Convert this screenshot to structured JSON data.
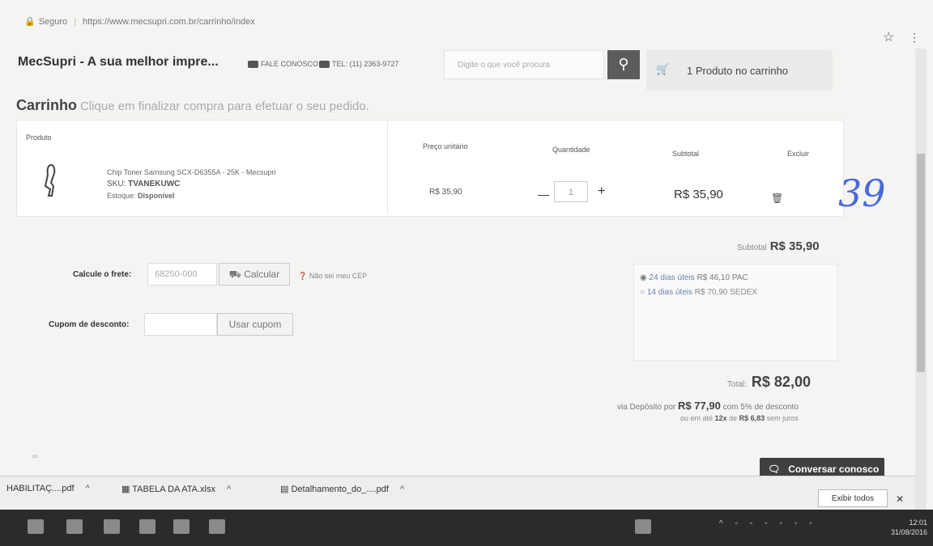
{
  "browser": {
    "secure_label": "Seguro",
    "url": "https://www.mecsupri.com.br/carrinho/index"
  },
  "header": {
    "site_title": "MecSupri - A sua melhor impre...",
    "contact_label": "FALE CONOSCO",
    "phone_label": "TEL: (11) 2363-9727",
    "search_placeholder": "Digite o que você procura",
    "cart_label": "1 Produto no carrinho"
  },
  "page": {
    "title": "Carrinho",
    "subtitle": "Clique em finalizar compra para efetuar o seu pedido."
  },
  "table": {
    "headers": {
      "product": "Produto",
      "unit_price": "Preço unitário",
      "quantity": "Quantidade",
      "subtotal": "Subtotal",
      "delete": "Excluir"
    },
    "rows": [
      {
        "name": "Chip Toner Samsung SCX-D6355A - 25K - Mecsupri",
        "sku_label": "SKU:",
        "sku": "TVANEKUWC",
        "stock_label": "Estoque:",
        "stock": "Disponível",
        "unit_price": "R$ 35,90",
        "quantity": "1",
        "subtotal": "R$ 35,90"
      }
    ]
  },
  "handwritten_note": "39",
  "summary": {
    "subtotal_label": "Subtotal",
    "subtotal_value": "R$ 35,90",
    "shipping_label": "Calcule o frete:",
    "cep_value": "68250-000",
    "calc_button": "Calcular",
    "cep_help": "Não sei meu CEP",
    "shipping_options": [
      {
        "days": "24 dias úteis",
        "price": "R$ 46,10",
        "carrier": "PAC",
        "selected": true
      },
      {
        "days": "14 dias úteis",
        "price": "R$ 70,90",
        "carrier": "SEDEX",
        "selected": false
      }
    ],
    "coupon_label": "Cupom de desconto:",
    "coupon_button": "Usar cupom",
    "total_label": "Total:",
    "total_value": "R$ 82,00",
    "deposit_prefix": "via Depósito por",
    "deposit_value": "R$ 77,90",
    "deposit_suffix": "com 5% de desconto",
    "installment_prefix": "ou em até",
    "installment_count": "12x",
    "installment_of": "de",
    "installment_value": "R$ 6,83",
    "installment_suffix": "sem juros"
  },
  "chat_button": "Conversar conosco",
  "downloads": {
    "items": [
      "HABILITAÇ....pdf",
      "TABELA DA ATA.xlsx",
      "Detalhamento_do_....pdf"
    ],
    "show_all": "Exibir todos"
  },
  "taskbar": {
    "time": "12:01",
    "date": "31/08/2016"
  },
  "colors": {
    "accent_dark": "#404040",
    "link_blue": "#6a7fb0",
    "handwriting": "#4a6ad8"
  }
}
